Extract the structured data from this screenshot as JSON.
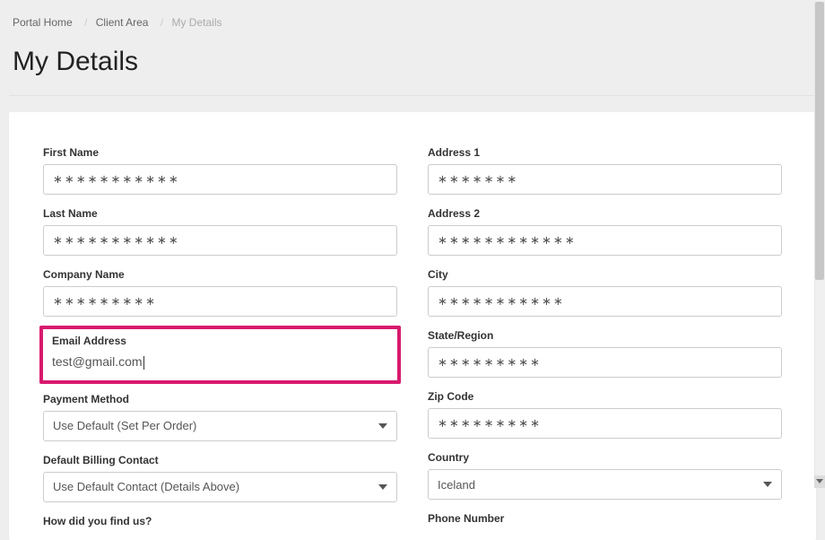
{
  "breadcrumb": {
    "portal_home": "Portal Home",
    "client_area": "Client Area",
    "current": "My Details"
  },
  "title": "My Details",
  "left": {
    "first_name_label": "First Name",
    "first_name_value": "∗∗∗∗∗∗∗∗∗∗∗",
    "last_name_label": "Last Name",
    "last_name_value": "∗∗∗∗∗∗∗∗∗∗∗",
    "company_label": "Company Name",
    "company_value": "∗∗∗∗∗∗∗∗∗",
    "email_label": "Email Address",
    "email_value": "test@gmail.com",
    "payment_label": "Payment Method",
    "payment_value": "Use Default (Set Per Order)",
    "billing_label": "Default Billing Contact",
    "billing_value": "Use Default Contact (Details Above)",
    "find_us_label": "How did you find us?"
  },
  "right": {
    "address1_label": "Address 1",
    "address1_value": "∗∗∗∗∗∗∗",
    "address2_label": "Address 2",
    "address2_value": "∗∗∗∗∗∗∗∗∗∗∗∗",
    "city_label": "City",
    "city_value": "∗∗∗∗∗∗∗∗∗∗∗",
    "state_label": "State/Region",
    "state_value": "∗∗∗∗∗∗∗∗∗",
    "zip_label": "Zip Code",
    "zip_value": "∗∗∗∗∗∗∗∗∗",
    "country_label": "Country",
    "country_value": "Iceland",
    "phone_label": "Phone Number"
  }
}
